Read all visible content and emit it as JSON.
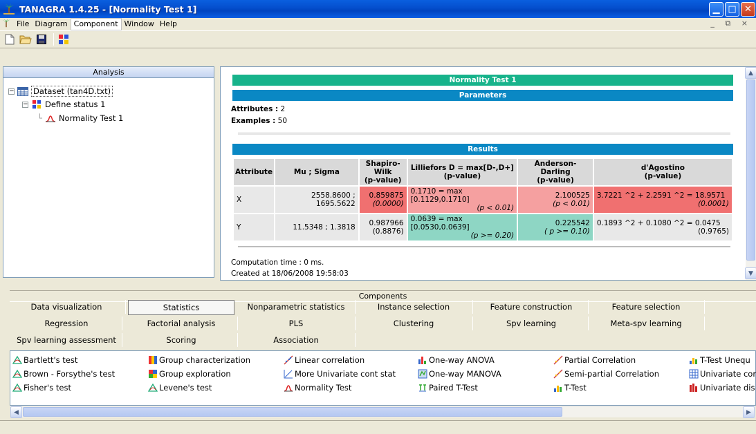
{
  "window": {
    "title": "TANAGRA 1.4.25 - [Normality Test 1]"
  },
  "menu": {
    "file": "File",
    "diagram": "Diagram",
    "component": "Component",
    "window": "Window",
    "help": "Help"
  },
  "analysis": {
    "header": "Analysis",
    "tree": {
      "dataset": "Dataset (tan4D.txt)",
      "define_status": "Define status 1",
      "normality": "Normality Test 1"
    }
  },
  "report": {
    "title": "Normality Test 1",
    "parameters_header": "Parameters",
    "attributes_label": "Attributes :",
    "attributes_value": "2",
    "examples_label": "Examples :",
    "examples_value": "50",
    "results_header": "Results",
    "columns": [
      "Attribute",
      "Mu ; Sigma",
      "Shapiro-Wilk",
      "(p-value)",
      "Lilliefors D = max[D-,D+]",
      "(p-value)",
      "Anderson-Darling",
      "(p-value)",
      "d'Agostino",
      "(p-value)"
    ],
    "rows": [
      {
        "attr": "X",
        "mu": "2558.8600 ; 1695.5622",
        "sw": "0.859875",
        "sw_p": "(0.0000)",
        "lf": "0.1710 = max [0.1129,0.1710]",
        "lf_p": "(p < 0.01)",
        "ad": "2.100525",
        "ad_p": "(p < 0.01)",
        "da": "3.7221 ^2 + 2.2591 ^2 = 18.9571",
        "da_p": "(0.0001)"
      },
      {
        "attr": "Y",
        "mu": "11.5348 ; 1.3818",
        "sw": "0.987966",
        "sw_p": "(0.8876)",
        "lf": "0.0639 = max [0.0530,0.0639]",
        "lf_p": "(p >= 0.20)",
        "ad": "0.225542",
        "ad_p": "( p >= 0.10)",
        "da": "0.1893 ^2 + 0.1080 ^2 = 0.0475",
        "da_p": "(0.9765)"
      }
    ],
    "computation": "Computation time : 0 ms.",
    "created": "Created at 18/06/2008 19:58:03"
  },
  "components": {
    "header": "Components",
    "tabs_row1": [
      "Data visualization",
      "Statistics",
      "Nonparametric statistics",
      "Instance selection",
      "Feature construction",
      "Feature selection"
    ],
    "tabs_row2": [
      "Regression",
      "Factorial analysis",
      "PLS",
      "Clustering",
      "Spv learning",
      "Meta-spv learning"
    ],
    "tabs_row3": [
      "Spv learning assessment",
      "Scoring",
      "Association"
    ],
    "items": {
      "c1": [
        "Bartlett's test",
        "Brown - Forsythe's test",
        "Fisher's test"
      ],
      "c2": [
        "Group characterization",
        "Group exploration",
        "Levene's test"
      ],
      "c3": [
        "Linear correlation",
        "More Univariate cont stat",
        "Normality Test"
      ],
      "c4": [
        "One-way ANOVA",
        "One-way MANOVA",
        "Paired T-Test"
      ],
      "c5": [
        "Partial Correlation",
        "Semi-partial Correlation",
        "T-Test"
      ],
      "c6": [
        "T-Test Unequ",
        "Univariate cor",
        "Univariate dis"
      ]
    }
  }
}
